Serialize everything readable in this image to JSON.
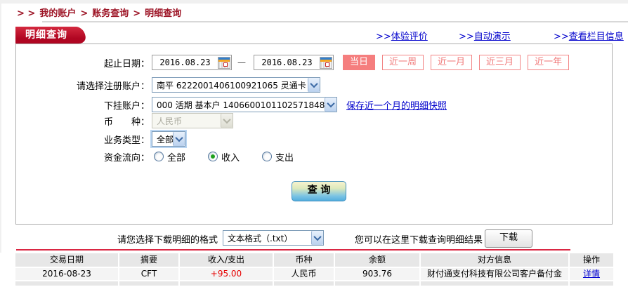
{
  "colors": {
    "accent_red": "#b00622",
    "salmon": "#f57e7e",
    "link_blue": "#0000cc",
    "amount_red": "#e60000",
    "breadcrumb_red": "#9d1526"
  },
  "breadcrumb": {
    "prefix": "> >",
    "separator": ">",
    "items": [
      "我的账户",
      "账务查询",
      "明细查询"
    ]
  },
  "header": {
    "tab_title": "明细查询",
    "link_prefix": ">>",
    "links": [
      {
        "label": "体验评价"
      },
      {
        "label": "自动演示"
      },
      {
        "label": "查看栏目信息"
      }
    ]
  },
  "form": {
    "date_range": {
      "label": "起止日期：",
      "start": "2016.08.23",
      "end": "2016.08.23",
      "dash": "—",
      "quick_buttons": [
        {
          "label": "当日",
          "active": true
        },
        {
          "label": "近一周",
          "active": false
        },
        {
          "label": "近一月",
          "active": false
        },
        {
          "label": "近三月",
          "active": false
        },
        {
          "label": "近一年",
          "active": false
        }
      ]
    },
    "register_account": {
      "label": "请选择注册账户：",
      "value": "南平 6222001406100921065 灵通卡"
    },
    "sub_account": {
      "label": "下挂账户：",
      "value": "000 活期 基本户 1406600101102571848",
      "snapshot_link": "保存近一个月的明细快照"
    },
    "currency": {
      "label": "币　　种：",
      "value": "人民币",
      "disabled": true
    },
    "business_type": {
      "label": "业务类型：",
      "value": "全部"
    },
    "fund_flow": {
      "label": "资金流向：",
      "options": [
        {
          "label": "全部",
          "checked": false
        },
        {
          "label": "收入",
          "checked": true
        },
        {
          "label": "支出",
          "checked": false
        }
      ]
    },
    "query_button": "查 询"
  },
  "download": {
    "format_label": "请您选择下载明细的格式",
    "format_value": "文本格式（.txt）",
    "hint": "您可以在这里下载查询明细结果",
    "button": "下载"
  },
  "table": {
    "headers": [
      "交易日期",
      "摘要",
      "收入/支出",
      "币种",
      "余额",
      "对方信息",
      "操作"
    ],
    "rows": [
      {
        "date": "2016-08-23",
        "summary": "CFT",
        "amount": "+95.00",
        "currency": "人民币",
        "balance": "903.76",
        "counterparty": "财付通支付科技有限公司客户备付金",
        "action": "详情"
      }
    ]
  }
}
